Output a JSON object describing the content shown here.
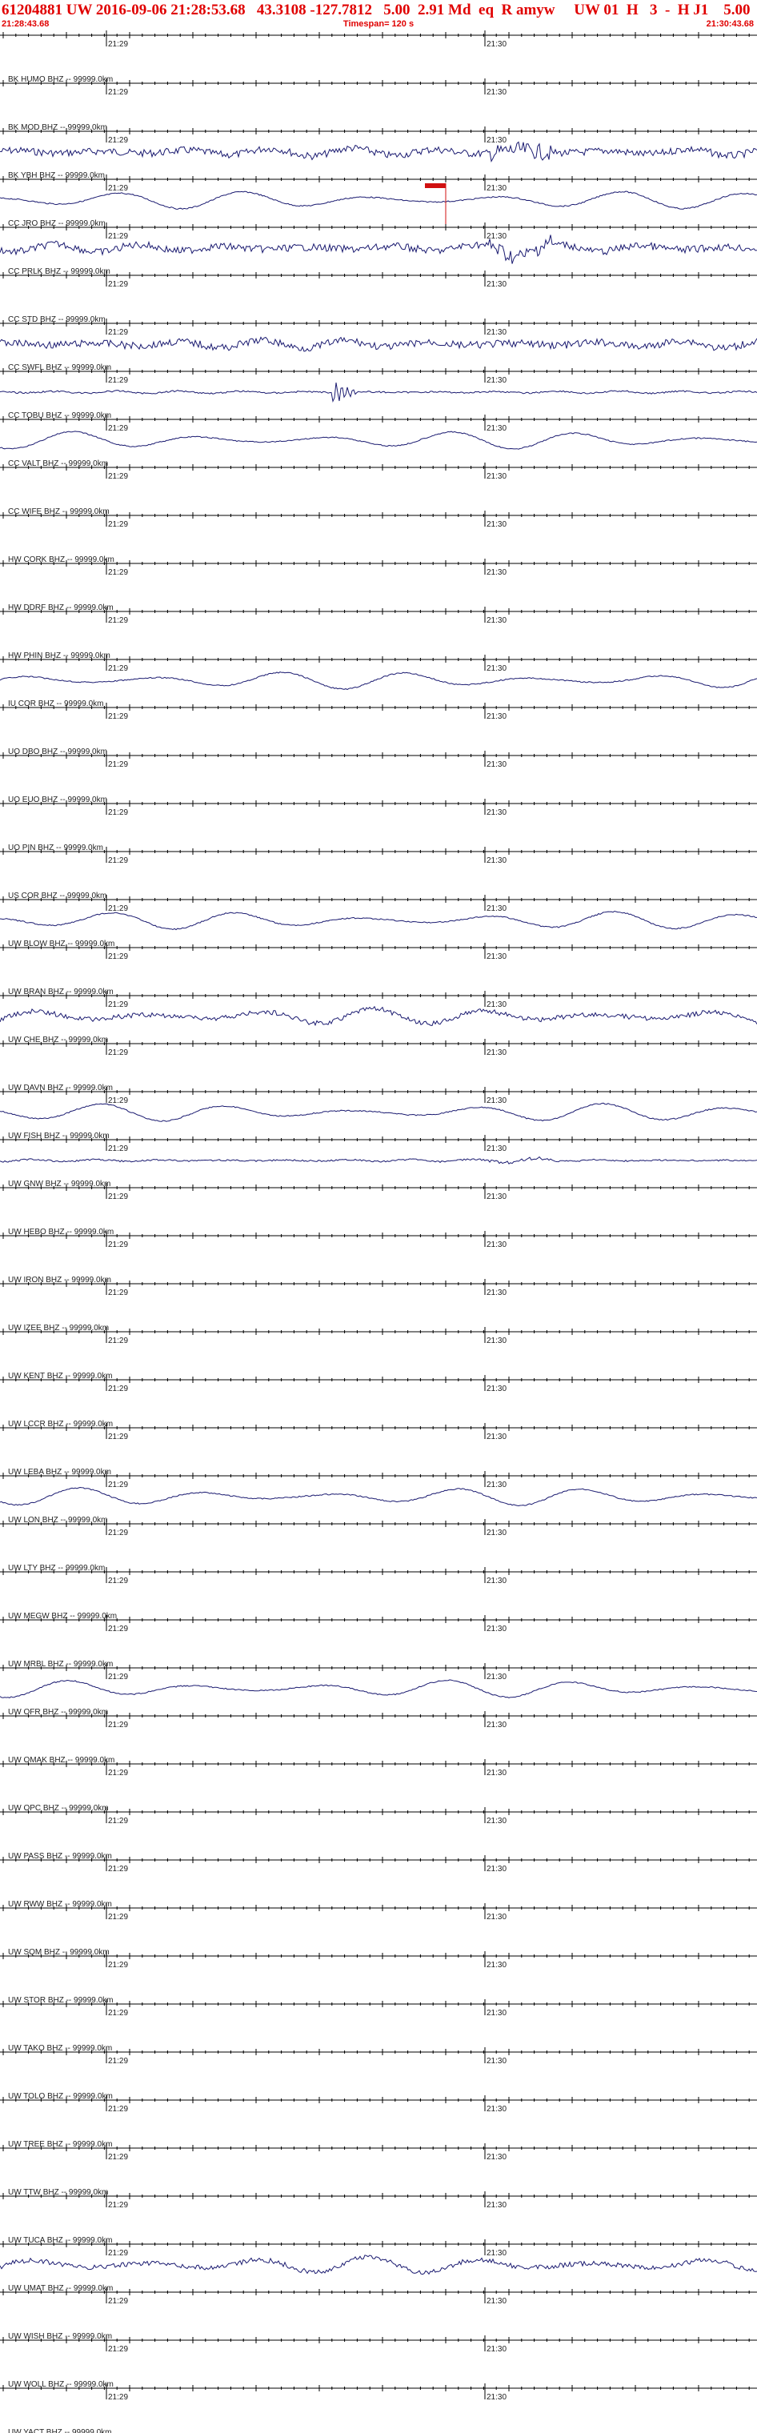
{
  "header": {
    "title": "61204881 UW 2016-09-06 21:28:53.68   43.3108 -127.7812   5.00  2.91 Md  eq  R amyw     UW 01  H   3  -  H J1    5.00  0.00",
    "start_time": "21:28:43.68",
    "timespan": "Timespan= 120 s",
    "end_time": "21:30:43.68",
    "colors": {
      "header_text": "#e00000",
      "trace": "#1a1a70",
      "axis": "#000000",
      "pick_marker": "#d01010"
    }
  },
  "minute_labels": [
    "21:29",
    "21:30"
  ],
  "channels": [
    {
      "label": "BK HUMO BHZ -- 99999.0km",
      "active": false
    },
    {
      "label": "BK MOD BHZ -- 99999.0km",
      "active": false
    },
    {
      "label": "BK YBH BHZ -- 99999.0km",
      "active": true,
      "style": "noisy",
      "event": true
    },
    {
      "label": "CC JRO BHZ -- 99999.0km",
      "active": true,
      "style": "wave",
      "pick": true
    },
    {
      "label": "CC PRLK BHZ -- 99999.0km",
      "active": true,
      "style": "noisy",
      "event": true
    },
    {
      "label": "CC STD BHZ -- 99999.0km",
      "active": false
    },
    {
      "label": "CC SWFL BHZ -- 99999.0km",
      "active": true,
      "style": "noisy"
    },
    {
      "label": "CC TOBU BHZ -- 99999.0km",
      "active": true,
      "style": "flat",
      "spike": true
    },
    {
      "label": "CC VALT BHZ -- 99999.0km",
      "active": true,
      "style": "wave"
    },
    {
      "label": "CC WIFE BHZ -- 99999.0km",
      "active": false
    },
    {
      "label": "HW CORK BHZ -- 99999.0km",
      "active": false
    },
    {
      "label": "HW DDRF BHZ -- 99999.0km",
      "active": false
    },
    {
      "label": "HW PHIN BHZ -- 99999.0km",
      "active": false
    },
    {
      "label": "IU COR BHZ -- 99999.0km",
      "active": true,
      "style": "wave"
    },
    {
      "label": "UO DBO BHZ -- 99999.0km",
      "active": false
    },
    {
      "label": "UO EUO BHZ -- 99999.0km",
      "active": false
    },
    {
      "label": "UO PIN BHZ -- 99999.0km",
      "active": false
    },
    {
      "label": "US COR BHZ -- 99999.0km",
      "active": false
    },
    {
      "label": "UW BLOW BHZ -- 99999.0km",
      "active": true,
      "style": "wave"
    },
    {
      "label": "UW BRAN BHZ -- 99999.0km",
      "active": false
    },
    {
      "label": "UW CHE BHZ -- 99999.0km",
      "active": true,
      "style": "noisywave"
    },
    {
      "label": "UW DAVN BHZ -- 99999.0km",
      "active": false
    },
    {
      "label": "UW FISH BHZ -- 99999.0km",
      "active": true,
      "style": "wave"
    },
    {
      "label": "UW GNW BHZ -- 99999.0km",
      "active": true,
      "style": "flat",
      "event": true
    },
    {
      "label": "UW HEBO BHZ -- 99999.0km",
      "active": false
    },
    {
      "label": "UW IRON BHZ -- 99999.0km",
      "active": false
    },
    {
      "label": "UW IZEE BHZ -- 99999.0km",
      "active": false
    },
    {
      "label": "UW KENT BHZ -- 99999.0km",
      "active": false
    },
    {
      "label": "UW LCCR BHZ -- 99999.0km",
      "active": false
    },
    {
      "label": "UW LEBA BHZ -- 99999.0km",
      "active": false
    },
    {
      "label": "UW LON BHZ -- 99999.0km",
      "active": true,
      "style": "wave"
    },
    {
      "label": "UW LTY BHZ -- 99999.0km",
      "active": false
    },
    {
      "label": "UW MEGW BHZ -- 99999.0km",
      "active": false
    },
    {
      "label": "UW MRBL BHZ -- 99999.0km",
      "active": false
    },
    {
      "label": "UW OFR BHZ -- 99999.0km",
      "active": true,
      "style": "wave"
    },
    {
      "label": "UW OMAK BHZ -- 99999.0km",
      "active": false
    },
    {
      "label": "UW OPC BHZ -- 99999.0km",
      "active": false
    },
    {
      "label": "UW PASS BHZ -- 99999.0km",
      "active": false
    },
    {
      "label": "UW RWW BHZ -- 99999.0km",
      "active": false
    },
    {
      "label": "UW SQM BHZ -- 99999.0km",
      "active": false
    },
    {
      "label": "UW STOR BHZ -- 99999.0km",
      "active": false
    },
    {
      "label": "UW TAKO BHZ -- 99999.0km",
      "active": false
    },
    {
      "label": "UW TOLO BHZ -- 99999.0km",
      "active": false
    },
    {
      "label": "UW TREE BHZ -- 99999.0km",
      "active": false
    },
    {
      "label": "UW TTW BHZ -- 99999.0km",
      "active": false
    },
    {
      "label": "UW TUCA BHZ -- 99999.0km",
      "active": false
    },
    {
      "label": "UW UMAT BHZ -- 99999.0km",
      "active": true,
      "style": "noisywave"
    },
    {
      "label": "UW WISH BHZ -- 99999.0km",
      "active": false
    },
    {
      "label": "UW WOLL BHZ -- 99999.0km",
      "active": false
    },
    {
      "label": "UW YACT BHZ -- 99999.0km",
      "active": false
    }
  ]
}
